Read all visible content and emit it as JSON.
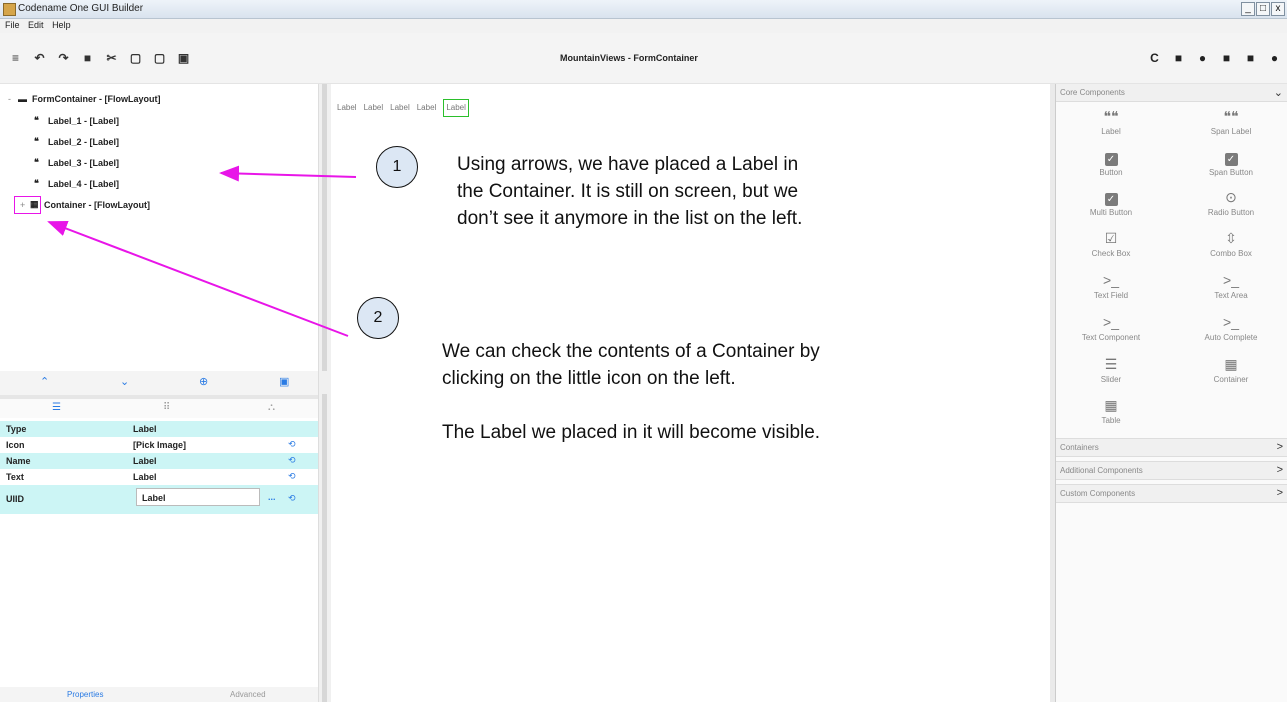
{
  "window": {
    "title": "Codename One GUI Builder",
    "controls": [
      "_",
      "□",
      "x"
    ]
  },
  "menu": [
    "File",
    "Edit",
    "Help"
  ],
  "toolbar": {
    "left_icons": [
      "menu-icon",
      "undo-icon",
      "redo-icon",
      "delete-icon",
      "cut-icon",
      "copy-icon",
      "paste-icon",
      "save-icon"
    ],
    "left_glyphs": [
      "≡",
      "↶",
      "↷",
      "■",
      "✂",
      "▢",
      "▢",
      "▣"
    ],
    "title": "MountainViews - FormContainer",
    "right_icons": [
      "refresh-icon",
      "preview-icon",
      "circle-icon",
      "desktop-icon",
      "lock-icon",
      "settings-icon"
    ],
    "right_glyphs": [
      "C",
      "■",
      "●",
      "■",
      "■",
      "●"
    ]
  },
  "tree": {
    "root": {
      "label": "FormContainer - [FlowLayout]",
      "toggle": "-",
      "icon": "folder-icon",
      "glyph": "▬"
    },
    "items": [
      {
        "label": "Label_1 - [Label]",
        "glyph": "❝"
      },
      {
        "label": "Label_2 - [Label]",
        "glyph": "❝"
      },
      {
        "label": "Label_3 - [Label]",
        "glyph": "❝"
      },
      {
        "label": "Label_4 - [Label]",
        "glyph": "❝"
      }
    ],
    "container": {
      "label": "Container - [FlowLayout]",
      "toggle": "+",
      "glyph": "▦"
    }
  },
  "tree_nav": {
    "up": "⌃",
    "down": "⌄",
    "add": "⊕",
    "save": "▣"
  },
  "prop_tabs": [
    "☰",
    "⠿",
    "⛬"
  ],
  "properties": {
    "rows": [
      {
        "key": "Type",
        "value": "Label",
        "reset": ""
      },
      {
        "key": "Icon",
        "value": "[Pick Image]",
        "reset": "⟲"
      },
      {
        "key": "Name",
        "value": "Label",
        "reset": "⟲"
      },
      {
        "key": "Text",
        "value": "Label",
        "reset": "⟲"
      }
    ],
    "uiid": {
      "key": "UIID",
      "value": "Label",
      "dots": "...",
      "reset": "⟲"
    }
  },
  "bottom_tabs": [
    "Properties",
    "Advanced"
  ],
  "canvas": {
    "labels": [
      "Label",
      "Label",
      "Label",
      "Label",
      "Label"
    ]
  },
  "palette": {
    "sections": [
      {
        "title": "Core Components",
        "chevron": "⌄"
      },
      {
        "title": "Containers",
        "chevron": ">"
      },
      {
        "title": "Additional Components",
        "chevron": ">"
      },
      {
        "title": "Custom Components",
        "chevron": ">"
      }
    ],
    "core": [
      {
        "label": "Label",
        "glyph": "❝❝"
      },
      {
        "label": "Span Label",
        "glyph": "❝❝"
      },
      {
        "label": "Button",
        "glyph": "✓"
      },
      {
        "label": "Span Button",
        "glyph": "✓"
      },
      {
        "label": "Multi Button",
        "glyph": "✓"
      },
      {
        "label": "Radio Button",
        "glyph": "⊙"
      },
      {
        "label": "Check Box",
        "glyph": "☑"
      },
      {
        "label": "Combo Box",
        "glyph": "⇳"
      },
      {
        "label": "Text Field",
        "glyph": ">_"
      },
      {
        "label": "Text Area",
        "glyph": ">_"
      },
      {
        "label": "Text Component",
        "glyph": ">_"
      },
      {
        "label": "Auto Complete",
        "glyph": ">_"
      },
      {
        "label": "Slider",
        "glyph": "☰"
      },
      {
        "label": "Container",
        "glyph": "▦"
      },
      {
        "label": "Table",
        "glyph": "▦"
      }
    ]
  },
  "annotations": {
    "callout1": {
      "number": "1",
      "lines": [
        "Using arrows, we have placed a Label in",
        "the Container. It is still on screen, but we",
        "don’t see it anymore in the list on the left."
      ]
    },
    "callout2": {
      "number": "2",
      "lines": [
        "We can check the contents of a Container by",
        "clicking on the little icon on the left.",
        "",
        "The Label we placed in it will become visible."
      ]
    },
    "arrow_color": "#e815e8",
    "badge_fill": "#dce7f4"
  }
}
